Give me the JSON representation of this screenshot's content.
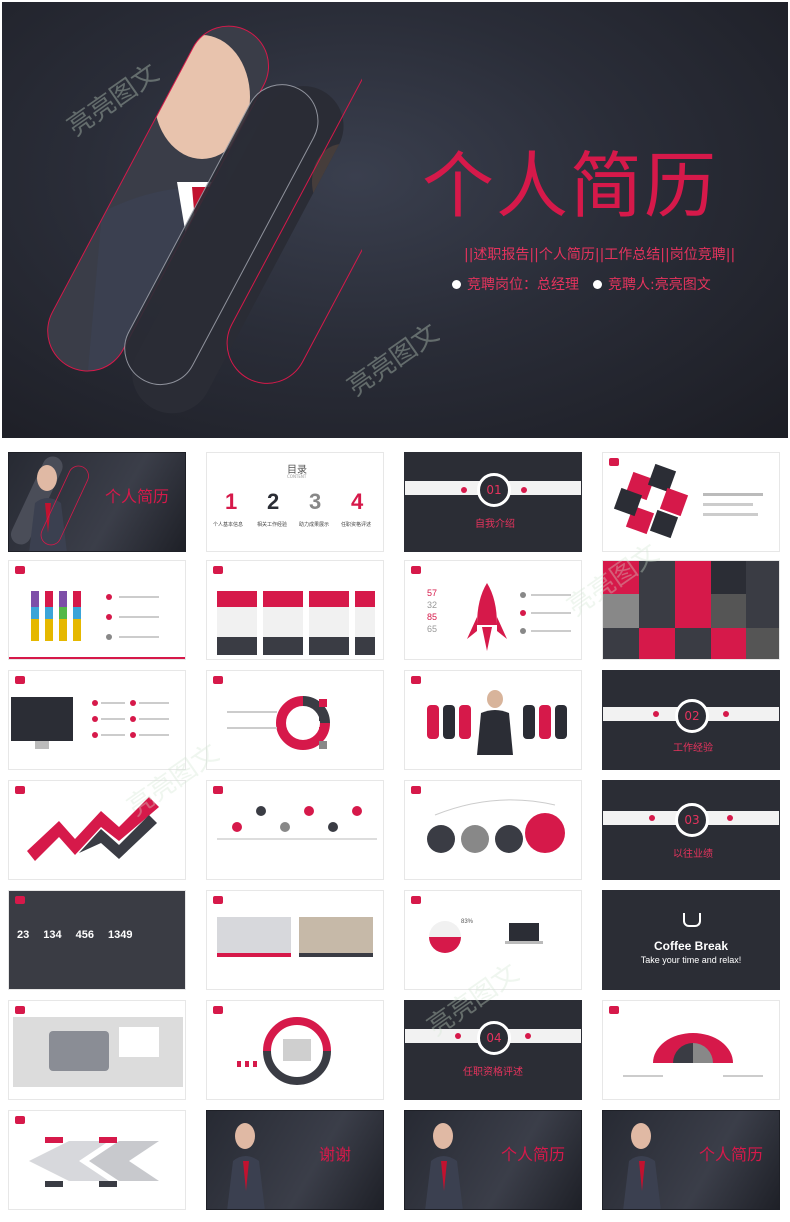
{
  "hero": {
    "title": "个人简历",
    "subtitle": "||述职报告||个人简历||工作总结||岗位竞聘||",
    "position": "竞聘岗位：总经理",
    "candidate": "竞聘人:亮亮图文"
  },
  "watermark": "亮亮图文",
  "thumbs": {
    "t1": "个人简历",
    "t2_title": "目录",
    "t2_sub": "CONTENT",
    "t2_nums": [
      "1",
      "2",
      "3",
      "4"
    ],
    "t2_labels": [
      "个人基本信息",
      "相关工作经验",
      "助力成果展示",
      "任职资格评述"
    ],
    "t3_num": "01",
    "t3_label": "自我介绍",
    "t12_num": "02",
    "t12_label": "工作经验",
    "t16_num": "03",
    "t16_label": "以往业绩",
    "t17_nums": [
      "23",
      "134",
      "456",
      "1349"
    ],
    "t20_title": "Coffee Break",
    "t20_sub": "Take your time and relax!",
    "t23_num": "04",
    "t23_label": "任职资格评述",
    "t26": "谢谢",
    "t27": "个人简历",
    "t28": "个人简历",
    "t6_vals": [
      "57",
      "32",
      "85",
      "65"
    ],
    "t19_pct": "83%"
  }
}
